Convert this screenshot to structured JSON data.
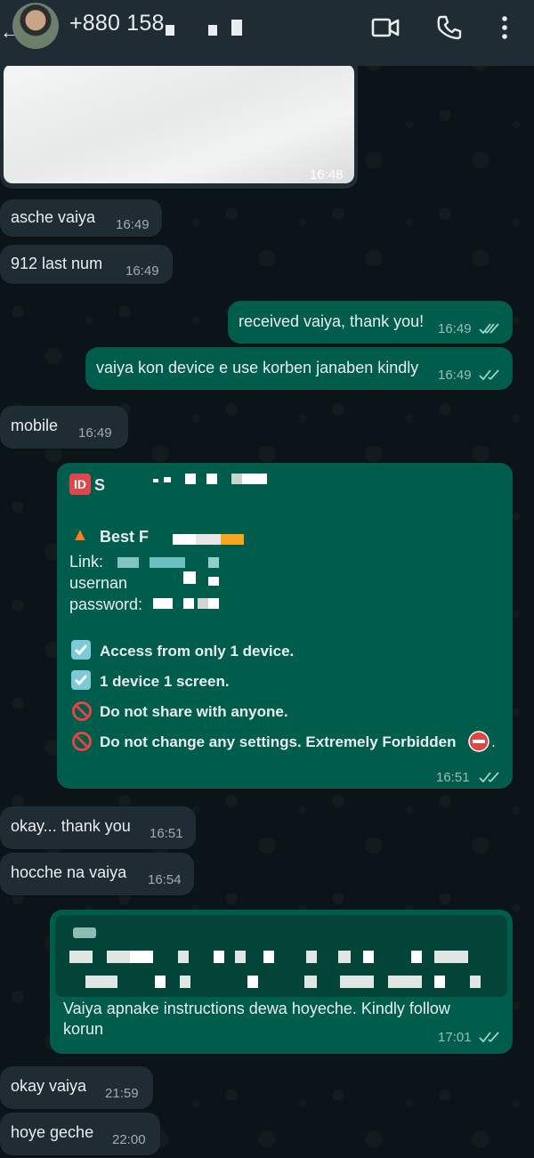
{
  "header": {
    "contact_name": "+880 158",
    "icons": [
      "back-arrow-icon",
      "video-call-icon",
      "voice-call-icon",
      "more-options-icon"
    ]
  },
  "messages": [
    {
      "id": "m0",
      "direction": "in",
      "type": "image",
      "time": "16:48"
    },
    {
      "id": "m1",
      "direction": "in",
      "text": "asche vaiya",
      "time": "16:49"
    },
    {
      "id": "m2",
      "direction": "in",
      "text": "912 last num",
      "time": "16:49"
    },
    {
      "id": "m3",
      "direction": "out",
      "text": "received vaiya, thank you!",
      "time": "16:49",
      "status": "read"
    },
    {
      "id": "m4",
      "direction": "out",
      "text": "vaiya kon device e use korben janaben kindly",
      "time": "16:49",
      "status": "read"
    },
    {
      "id": "m5",
      "direction": "in",
      "text": "mobile",
      "time": "16:49"
    },
    {
      "id": "m6",
      "direction": "out",
      "time": "16:51",
      "status": "read",
      "badge": "ID",
      "title_prefix": "S",
      "offer_label": "Best F",
      "link_label": "Link:",
      "username_label": "usernan",
      "password_label": "password:",
      "rules": [
        {
          "icon": "check-box-icon",
          "text": "Access from only 1 device."
        },
        {
          "icon": "check-box-icon",
          "text": "1 device 1 screen."
        },
        {
          "icon": "prohibited-icon",
          "text": "Do not share with anyone."
        },
        {
          "icon": "prohibited-icon",
          "text": "Do not change any settings. Extremely Forbidden"
        }
      ],
      "rules_end_icon": "no-entry-icon",
      "rules_end_text": "."
    },
    {
      "id": "m7",
      "direction": "in",
      "text": "okay... thank you",
      "time": "16:51"
    },
    {
      "id": "m8",
      "direction": "in",
      "text": "hocche na vaiya",
      "time": "16:54"
    },
    {
      "id": "m9",
      "direction": "out",
      "time": "17:01",
      "status": "read",
      "text_line1": "Vaiya apnake instructions dewa hoyeche.  Kindly follow",
      "text_line2": "korun"
    },
    {
      "id": "m10",
      "direction": "in",
      "text": "okay vaiya",
      "time": "21:59"
    },
    {
      "id": "m11",
      "direction": "in",
      "text": "hoye geche",
      "time": "22:00"
    }
  ],
  "colors": {
    "header_bg": "#1f2c33",
    "incoming_bg": "#1f2c33",
    "outgoing_bg": "#005c4b",
    "read_tick": "#9ad8cb"
  }
}
